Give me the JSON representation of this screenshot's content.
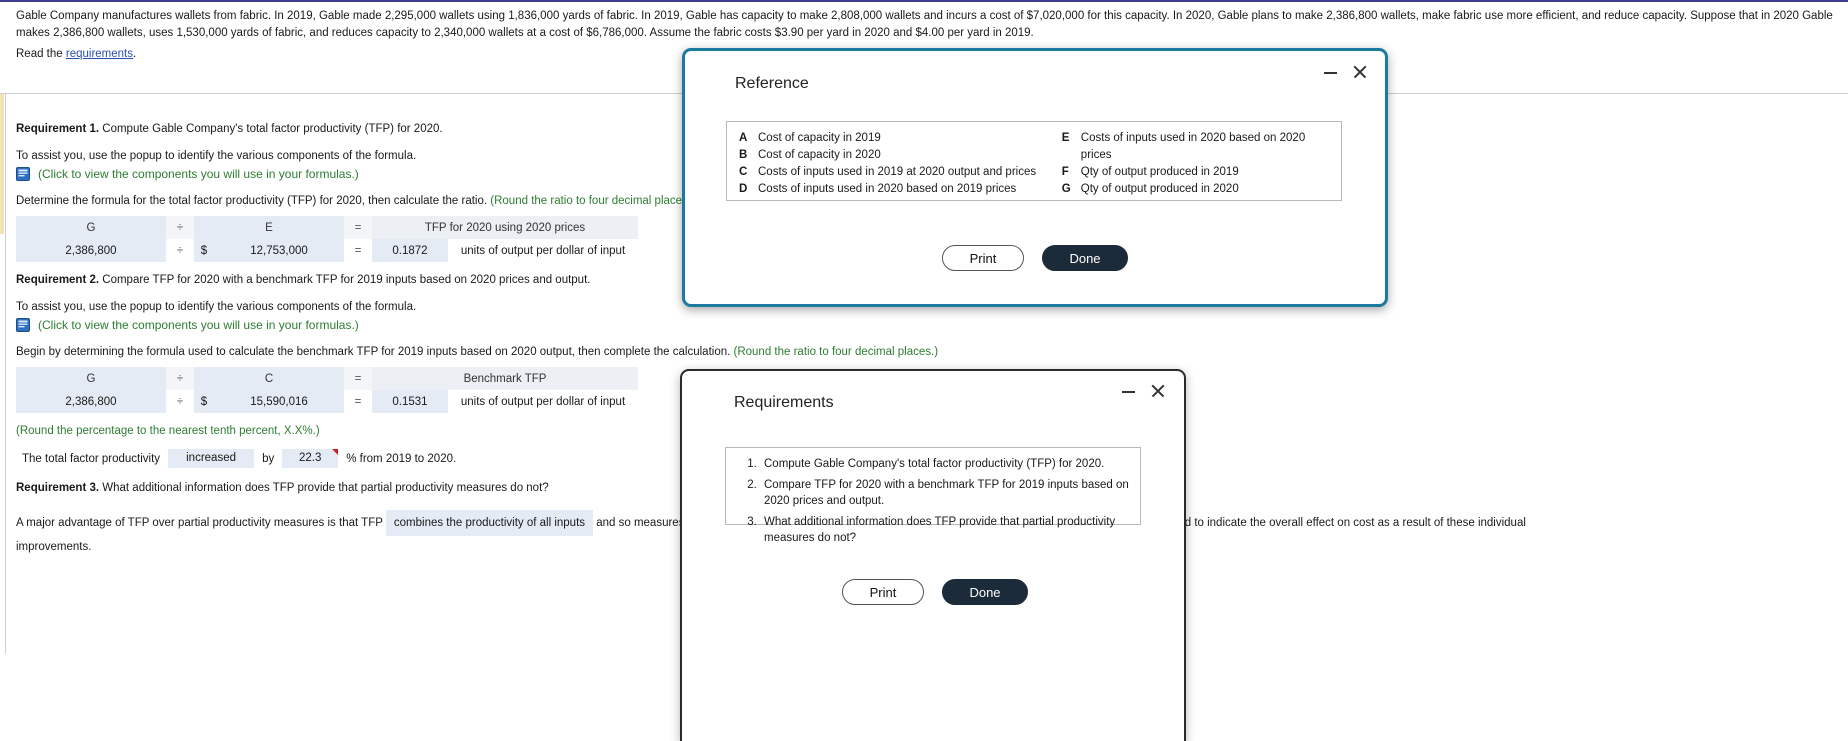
{
  "problem": {
    "statement": "Gable Company manufactures wallets from fabric. In 2019, Gable made 2,295,000 wallets using 1,836,000 yards of fabric. In 2019, Gable has capacity to make 2,808,000 wallets and incurs a cost of $7,020,000 for this capacity. In 2020, Gable plans to make 2,386,800 wallets, make fabric use more efficient, and reduce capacity. Suppose that in 2020 Gable makes 2,386,800 wallets, uses 1,530,000 yards of fabric, and reduces capacity to 2,340,000 wallets at a cost of $6,786,000. Assume the fabric costs $3.90 per yard in 2020 and $4.00 per yard in 2019.",
    "read_prefix": "Read the ",
    "read_link": "requirements",
    "read_suffix": "."
  },
  "requirement1": {
    "label": "Requirement 1.",
    "text": " Compute Gable Company's total factor productivity (TFP) for 2020.",
    "assist": "To assist you, use the popup to identify the various components of the formula.",
    "popup_link": "(Click to view the components you will use in your formulas.)",
    "instruction": "Determine the formula for the total factor productivity (TFP) for 2020, then calculate the ratio. ",
    "rounding": "(Round the ratio to four decimal places.)",
    "table": {
      "header": {
        "num": "G",
        "op1": "÷",
        "den": "E",
        "op2": "=",
        "result": "TFP for 2020 using 2020 prices"
      },
      "values": {
        "num": "2,386,800",
        "op1": "÷",
        "dollar": "$",
        "den": "12,753,000",
        "op2": "=",
        "result": "0.1872",
        "unit": "units of output per dollar of input"
      }
    }
  },
  "requirement2": {
    "label": "Requirement 2.",
    "text": " Compare TFP for 2020 with a benchmark TFP for 2019 inputs based on 2020 prices and output.",
    "assist": "To assist you, use the popup to identify the various components of the formula.",
    "popup_link": "(Click to view the components you will use in your formulas.)",
    "instruction": "Begin by determining the formula used to calculate the benchmark TFP for 2019 inputs based on 2020 output, then complete the calculation. ",
    "rounding": "(Round the ratio to four decimal places.)",
    "table": {
      "header": {
        "num": "G",
        "op1": "÷",
        "den": "C",
        "op2": "=",
        "result": "Benchmark TFP"
      },
      "values": {
        "num": "2,386,800",
        "op1": "÷",
        "dollar": "$",
        "den": "15,590,016",
        "op2": "=",
        "result": "0.1531",
        "unit": "units of output per dollar of input"
      }
    },
    "pct_rounding": "(Round the percentage to the nearest tenth percent, X.X%.)",
    "sentence": {
      "prefix": "The total factor productivity",
      "direction": "increased",
      "middle": "by",
      "percent": "22.3",
      "suffix": "% from 2019 to 2020."
    }
  },
  "requirement3": {
    "label": "Requirement 3.",
    "text": " What additional information does TFP provide that partial productivity measures do not?",
    "answer_prefix": "A major advantage of TFP over partial productivity measures is that TFP ",
    "answer_choice": "combines the productivity of all inputs",
    "answer_suffix": " and so measures gains from using fewer physical inputs, as well as the effects of price changes, which are combined to indicate the overall effect on cost as a result of these individual improvements."
  },
  "reference_dialog": {
    "title": "Reference",
    "items_left": [
      {
        "key": "A",
        "text": "Cost of capacity in 2019"
      },
      {
        "key": "B",
        "text": "Cost of capacity in 2020"
      },
      {
        "key": "C",
        "text": "Costs of inputs used in 2019 at 2020 output and prices"
      },
      {
        "key": "D",
        "text": "Costs of inputs used in 2020 based on 2019 prices"
      }
    ],
    "items_right": [
      {
        "key": "E",
        "text": "Costs of inputs used in 2020 based on 2020 prices"
      },
      {
        "key": "F",
        "text": "Qty of output produced in 2019"
      },
      {
        "key": "G",
        "text": "Qty of output produced in 2020"
      }
    ],
    "print_label": "Print",
    "done_label": "Done"
  },
  "requirements_dialog": {
    "title": "Requirements",
    "items": [
      "Compute Gable Company's total factor productivity (TFP) for 2020.",
      "Compare TFP for 2020 with a benchmark TFP for 2019 inputs based on 2020 prices and output.",
      "What additional information does TFP provide that partial productivity measures do not?"
    ],
    "print_label": "Print",
    "done_label": "Done"
  },
  "colors": {
    "green": "#2e7d32",
    "link": "#2b4fb8",
    "ref_border": "#1b7a9e",
    "cell_blue": "#e4ebf4",
    "done_bg": "#1c2b3a",
    "flag_red": "#cc2027"
  }
}
